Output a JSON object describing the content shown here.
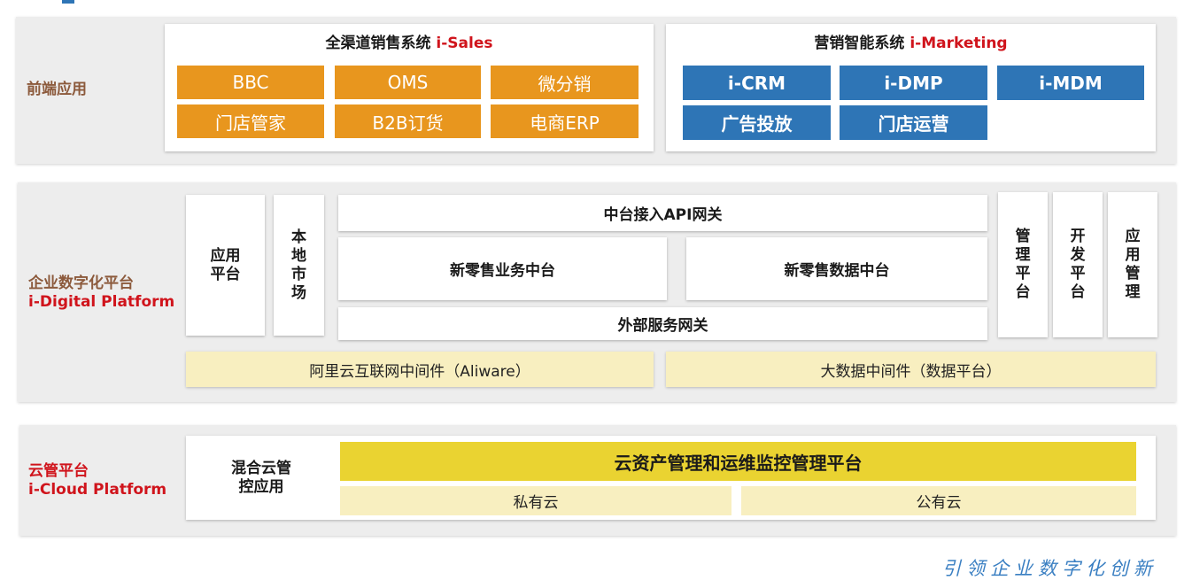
{
  "frontend": {
    "label": "前端应用",
    "sales": {
      "title": "全渠道销售系统 ",
      "title_accent": "i-Sales",
      "items": [
        "BBC",
        "OMS",
        "微分销",
        "门店管家",
        "B2B订货",
        "电商ERP"
      ]
    },
    "marketing": {
      "title": "营销智能系统 ",
      "title_accent": "i-Marketing",
      "items": [
        "i-CRM",
        "i-DMP",
        "i-MDM",
        "广告投放",
        "门店运营"
      ]
    }
  },
  "digital": {
    "label": "企业数字化平台",
    "label_en": "i-Digital Platform",
    "app_platform": "应用平台",
    "local_market": "本地市场",
    "api_gateway": "中台接入API网关",
    "business_center": "新零售业务中台",
    "data_center": "新零售数据中台",
    "external_gateway": "外部服务网关",
    "mgmt_platform": "管理平台",
    "dev_platform": "开发平台",
    "app_mgmt": "应用管理",
    "aliware": "阿里云互联网中间件（Aliware）",
    "bigdata": "大数据中间件（数据平台）"
  },
  "cloud": {
    "label": "云管平台",
    "label_en": "i-Cloud Platform",
    "hybrid": "混合云管控应用",
    "asset_mgmt": "云资产管理和运维监控管理平台",
    "private": "私有云",
    "public": "公有云"
  },
  "slogan": "引领企业数字化创新",
  "colors": {
    "orange": "#e8961e",
    "blue": "#2e75b6",
    "red": "#d0141c",
    "gold": "#ead331",
    "pale": "#f8efc0"
  }
}
